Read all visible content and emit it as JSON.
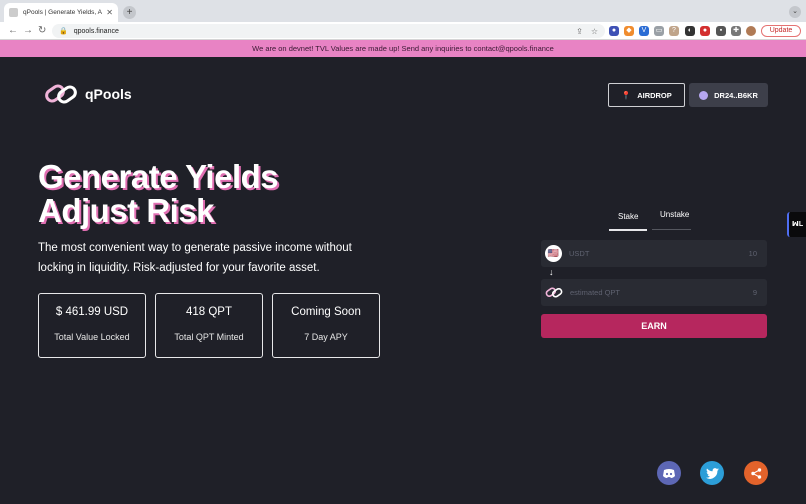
{
  "browser": {
    "tab_title": "qPools | Generate Yields, Adjust Risk",
    "new_tab_glyph": "+",
    "url": "qpools.finance",
    "update_label": "Update"
  },
  "banner": {
    "text": "We are on devnet! TVL Values are made up! Send any inquiries to contact@qpools.finance"
  },
  "header": {
    "logo_text": "qPools",
    "airdrop_label": "AIRDROP",
    "wallet_label": "DR24..B6KR"
  },
  "hero": {
    "title_line1": "Generate Yields",
    "title_line2": "Adjust Risk",
    "subtitle": "The most convenient way to generate passive income without locking in liquidity. Risk-adjusted for your favorite asset."
  },
  "stats": [
    {
      "value": "$ 461.99 USD",
      "label": "Total Value Locked"
    },
    {
      "value": "418 QPT",
      "label": "Total QPT Minted"
    },
    {
      "value": "Coming Soon",
      "label": "7 Day APY"
    }
  ],
  "stake_panel": {
    "tabs": [
      "Stake",
      "Unstake"
    ],
    "input": {
      "placeholder": "USDT",
      "value": "10"
    },
    "output": {
      "placeholder": "estimated QPT",
      "value": "9"
    },
    "earn_label": "EARN"
  },
  "side_widget_label": "ꟽL",
  "colors": {
    "banner": "#e883c4",
    "background": "#1f2028",
    "earn_button": "#b6275e",
    "accent_pink": "#e06fb2",
    "discord": "#5d67b5",
    "twitter": "#2c9ed8",
    "share": "#e3632b"
  },
  "icons": [
    "discord-icon",
    "twitter-icon",
    "share-icon"
  ]
}
